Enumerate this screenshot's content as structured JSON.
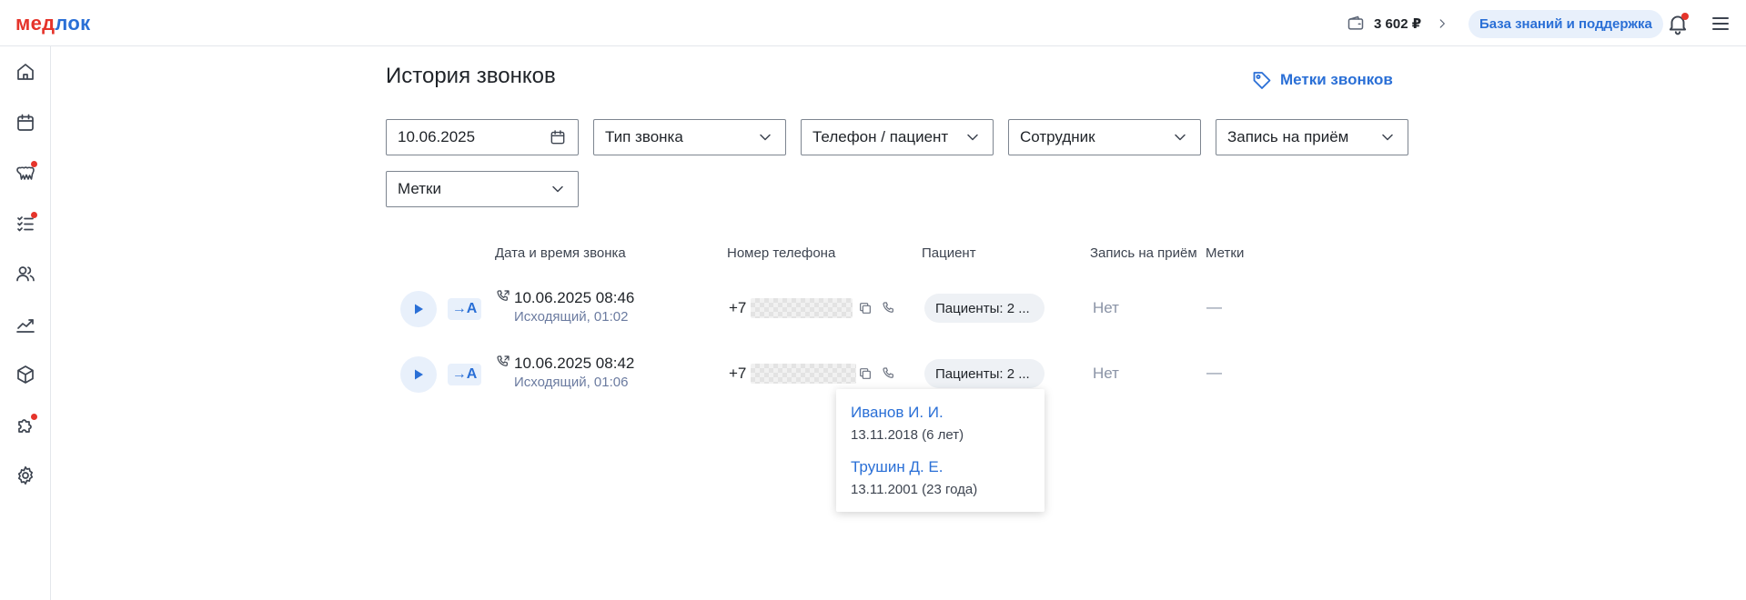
{
  "app": {
    "logo_part1": "мед",
    "logo_part2": "лок",
    "balance": "3 602 ₽",
    "help_button": "База знаний и поддержка"
  },
  "sidebar": {
    "items": [
      {
        "name": "home",
        "icon": "home-icon",
        "badge": false
      },
      {
        "name": "calendar",
        "icon": "calendar-icon",
        "badge": false
      },
      {
        "name": "teeth",
        "icon": "teeth-icon",
        "badge": true
      },
      {
        "name": "tasks",
        "icon": "checklist-icon",
        "badge": true
      },
      {
        "name": "users",
        "icon": "users-icon",
        "badge": false
      },
      {
        "name": "analytics",
        "icon": "chart-icon",
        "badge": false
      },
      {
        "name": "warehouse",
        "icon": "box-icon",
        "badge": false
      },
      {
        "name": "integrations",
        "icon": "puzzle-icon",
        "badge": true
      },
      {
        "name": "settings",
        "icon": "gear-icon",
        "badge": false
      }
    ]
  },
  "page": {
    "title": "История звонков",
    "tags_link": "Метки звонков"
  },
  "filters": {
    "date": "10.06.2025",
    "call_type": "Тип звонка",
    "phone_patient": "Телефон / пациент",
    "employee": "Сотрудник",
    "appointment": "Запись на приём",
    "tags": "Метки"
  },
  "table": {
    "headers": {
      "datetime": "Дата и время звонка",
      "phone": "Номер телефона",
      "patient": "Пациент",
      "appointment": "Запись на приём",
      "tags": "Метки"
    },
    "rows": [
      {
        "direction": "→A",
        "datetime": "10.06.2025 08:46",
        "meta": "Исходящий, 01:02",
        "phone_prefix": "+7",
        "patients": "Пациенты: 2 ...",
        "appointment": "Нет",
        "tags": "—"
      },
      {
        "direction": "→A",
        "datetime": "10.06.2025 08:42",
        "meta": "Исходящий, 01:06",
        "phone_prefix": "+7",
        "patients": "Пациенты: 2 ...",
        "appointment": "Нет",
        "tags": "—"
      }
    ]
  },
  "popover": {
    "patients": [
      {
        "name": "Иванов И. И.",
        "dob": "13.11.2018 (6 лет)"
      },
      {
        "name": "Трушин Д. Е.",
        "dob": "13.11.2001 (23 года)"
      }
    ]
  },
  "colors": {
    "brand_red": "#e5342b",
    "brand_blue": "#2a6fd6",
    "muted_text": "#8a93a6"
  }
}
